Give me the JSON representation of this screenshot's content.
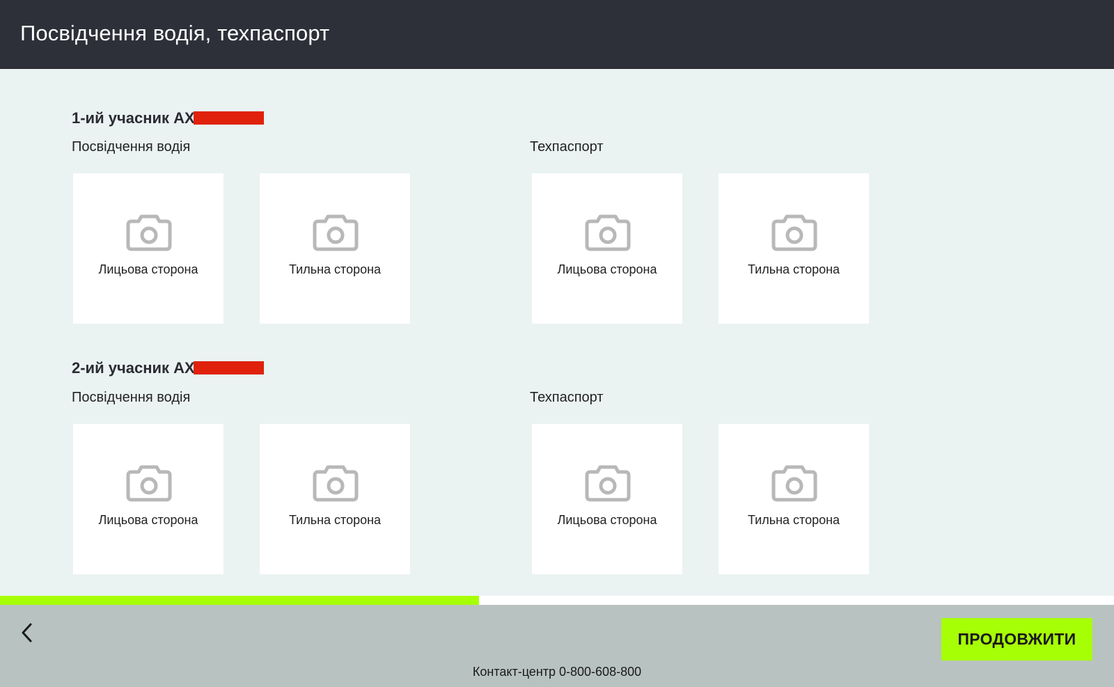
{
  "header": {
    "title": "Посвідчення водія, техпаспорт"
  },
  "participants": [
    {
      "title": "1-ий учасник AX",
      "license": {
        "label": "Посвідчення водія",
        "front": "Лицьова сторона",
        "back": "Тильна сторона"
      },
      "registration": {
        "label": "Техпаспорт",
        "front": "Лицьова сторона",
        "back": "Тильна сторона"
      }
    },
    {
      "title": "2-ий учасник AX",
      "license": {
        "label": "Посвідчення водія",
        "front": "Лицьова сторона",
        "back": "Тильна сторона"
      },
      "registration": {
        "label": "Техпаспорт",
        "front": "Лицьова сторона",
        "back": "Тильна сторона"
      }
    }
  ],
  "progress": {
    "fraction": 0.43
  },
  "footer": {
    "continue_label": "ПРОДОВЖИТИ",
    "contact": "Контакт-центр 0-800-608-800"
  },
  "icons": {
    "tile": "camera-icon",
    "back": "chevron-left-icon"
  },
  "colors": {
    "accent": "#a7ff06",
    "header_bg": "#2e3039",
    "page_bg": "#eaf3f2",
    "footer_bg": "#b8c2c1",
    "redaction": "#e0210b"
  }
}
